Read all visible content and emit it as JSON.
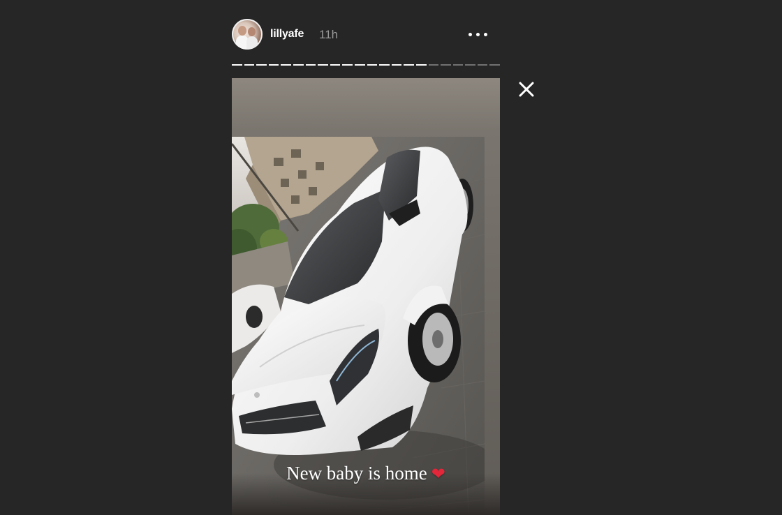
{
  "story": {
    "username": "lillyafe",
    "timestamp": "11h",
    "progress_segments_total": 22,
    "progress_segments_done": 16,
    "caption": "New baby is home",
    "caption_emoji": "❤"
  },
  "icons": {
    "more": "more-horizontal-icon",
    "close": "close-icon"
  },
  "colors": {
    "background": "#262626",
    "text": "#ffffff",
    "timestamp": "#9a9a9a",
    "heart": "#e3263a"
  }
}
